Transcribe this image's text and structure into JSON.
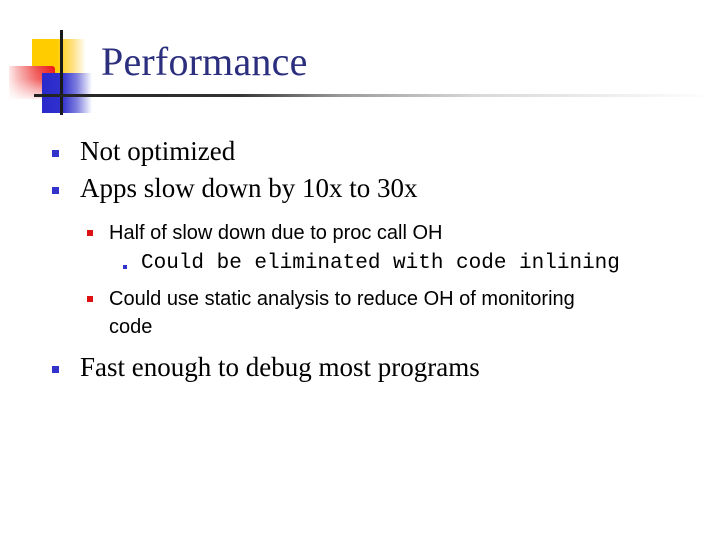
{
  "slide": {
    "title": "Performance",
    "colors": {
      "title": "#2B2F7E",
      "bullet_level1": "#3333CC",
      "bullet_level2": "#DD1111",
      "bullet_level3": "#3333CC",
      "logo_yellow": "#FFCC00",
      "logo_red": "#EE1111",
      "logo_blue": "#2A2ACC"
    },
    "bullets": [
      {
        "level": 1,
        "text": "Not optimized"
      },
      {
        "level": 1,
        "text": "Apps slow down by 10x to 30x"
      },
      {
        "level": 2,
        "text": "Half of slow down due to proc call OH"
      },
      {
        "level": 3,
        "text": "Could be eliminated with code inlining"
      },
      {
        "level": 2,
        "text_line1": "Could use static analysis to reduce OH of monitoring",
        "text_line2": "code"
      },
      {
        "level": 1,
        "text": "Fast enough to debug most programs"
      }
    ]
  }
}
